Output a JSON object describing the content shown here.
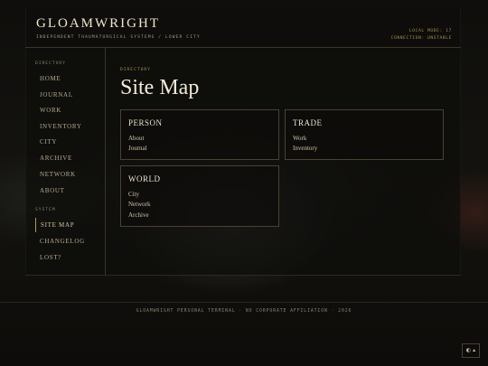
{
  "header": {
    "logo": "GLOAMWRIGHT",
    "tagline": "INDEPENDENT THAUMATURGICAL SYSTEMS / LOWER CITY",
    "status_mode": "LOCAL MODE: 17",
    "status_connection": "CONNECTION: UNSTABLE"
  },
  "sidebar": {
    "directory_label": "DIRECTORY",
    "directory_items": [
      {
        "label": "HOME"
      },
      {
        "label": "JOURNAL"
      },
      {
        "label": "WORK"
      },
      {
        "label": "INVENTORY"
      },
      {
        "label": "CITY"
      },
      {
        "label": "ARCHIVE"
      },
      {
        "label": "NETWORK"
      },
      {
        "label": "ABOUT"
      }
    ],
    "system_label": "SYSTEM",
    "system_items": [
      {
        "label": "SITE MAP",
        "active": true
      },
      {
        "label": "CHANGELOG"
      },
      {
        "label": "LOST?"
      }
    ]
  },
  "main": {
    "breadcrumb": "DIRECTORY",
    "title": "Site Map",
    "cards": [
      {
        "heading": "PERSON",
        "links": [
          "About",
          "Journal"
        ]
      },
      {
        "heading": "TRADE",
        "links": [
          "Work",
          "Inventory"
        ]
      },
      {
        "heading": "WORLD",
        "links": [
          "City",
          "Network",
          "Archive"
        ]
      }
    ]
  },
  "footer": {
    "text": "GLOAMWRIGHT PERSONAL TERMINAL · NO CORPORATE AFFILIATION · 2026"
  },
  "toggle": {
    "label": "◐ ▴"
  },
  "colors": {
    "accent": "#b8935a",
    "background": "#0d0c0a",
    "text": "#e6dcc4"
  }
}
